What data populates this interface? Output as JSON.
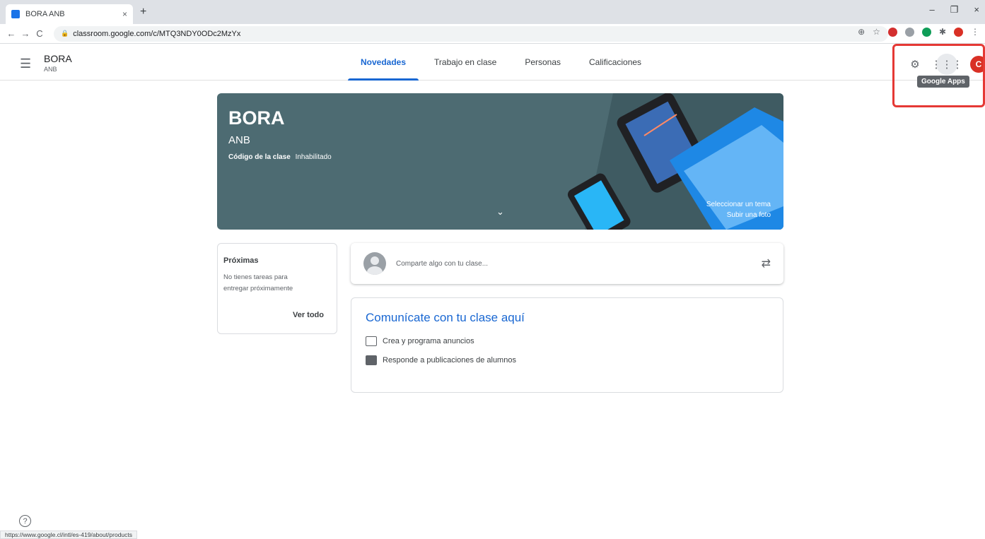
{
  "browser": {
    "tab_title": "BORA ANB",
    "tab_close": "×",
    "new_tab": "+",
    "url": "classroom.google.com/c/MTQ3NDY0ODc2MzYx",
    "window_min": "–",
    "window_max": "❐",
    "window_close": "×",
    "status_url": "https://www.google.cl/intl/es-419/about/products"
  },
  "header": {
    "course_title": "BORA",
    "course_section": "ANB",
    "tabs": [
      {
        "label": "Novedades",
        "active": true
      },
      {
        "label": "Trabajo en clase",
        "active": false
      },
      {
        "label": "Personas",
        "active": false
      },
      {
        "label": "Calificaciones",
        "active": false
      }
    ],
    "avatar_letter": "C",
    "tooltip": "Google Apps"
  },
  "banner": {
    "title": "BORA",
    "subtitle": "ANB",
    "code_label": "Código de la clase",
    "code_value": "Inhabilitado",
    "select_theme": "Seleccionar un tema",
    "upload_photo": "Subir una foto"
  },
  "upcoming": {
    "title": "Próximas",
    "text": "No tienes tareas para entregar próximamente",
    "link": "Ver todo"
  },
  "share": {
    "placeholder": "Comparte algo con tu clase..."
  },
  "communicate": {
    "title": "Comunícate con tu clase aquí",
    "items": [
      "Crea y programa anuncios",
      "Responde a publicaciones de alumnos"
    ]
  },
  "colors": {
    "accent": "#1967d2",
    "banner": "#4d6b72",
    "avatar": "#d93025",
    "highlight": "#e53935"
  }
}
